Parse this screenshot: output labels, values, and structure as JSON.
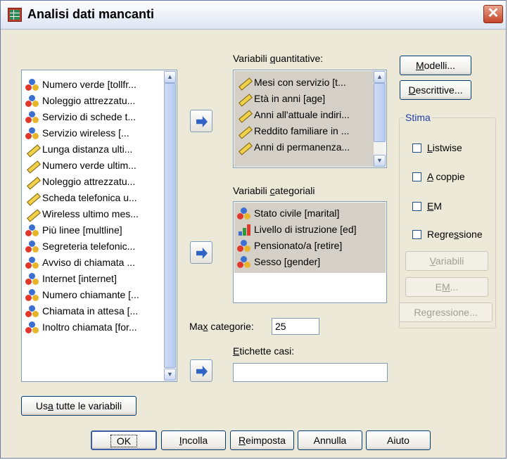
{
  "window": {
    "title": "Analisi dati mancanti",
    "close_glyph": "✕",
    "icon": "data-grid-icon"
  },
  "left_list": {
    "items": [
      {
        "label": "Numero verde [tollfr...",
        "type": "nominal"
      },
      {
        "label": "Noleggio attrezzatu...",
        "type": "nominal"
      },
      {
        "label": "Servizio di schede t...",
        "type": "nominal"
      },
      {
        "label": "Servizio wireless [...",
        "type": "nominal"
      },
      {
        "label": "Lunga distanza ulti...",
        "type": "scale"
      },
      {
        "label": "Numero verde ultim...",
        "type": "scale"
      },
      {
        "label": "Noleggio attrezzatu...",
        "type": "scale"
      },
      {
        "label": "Scheda telefonica u...",
        "type": "scale"
      },
      {
        "label": "Wireless ultimo mes...",
        "type": "scale"
      },
      {
        "label": "Più linee [multline]",
        "type": "nominal"
      },
      {
        "label": "Segreteria telefonic...",
        "type": "nominal"
      },
      {
        "label": "Avviso di chiamata ...",
        "type": "nominal"
      },
      {
        "label": "Internet [internet]",
        "type": "nominal"
      },
      {
        "label": "Numero chiamante [...",
        "type": "nominal"
      },
      {
        "label": "Chiamata in attesa [...",
        "type": "nominal"
      },
      {
        "label": "Inoltro chiamata [for...",
        "type": "nominal"
      }
    ]
  },
  "quantitative": {
    "label_pre": "Variabili ",
    "label_u": "q",
    "label_post": "uantitative:",
    "items": [
      {
        "label": "Mesi con servizio [t...",
        "type": "scale"
      },
      {
        "label": "Età in anni [age]",
        "type": "scale"
      },
      {
        "label": "Anni all'attuale indiri...",
        "type": "scale"
      },
      {
        "label": "Reddito familiare in ...",
        "type": "scale"
      },
      {
        "label": "Anni di permanenza...",
        "type": "scale"
      }
    ]
  },
  "categorical": {
    "label_pre": "Variabili ",
    "label_u": "c",
    "label_post": "ategoriali",
    "items": [
      {
        "label": "Stato civile [marital]",
        "type": "nominal"
      },
      {
        "label": "Livello di istruzione [ed]",
        "type": "ordinal"
      },
      {
        "label": "Pensionato/a [retire]",
        "type": "nominal"
      },
      {
        "label": "Sesso [gender]",
        "type": "nominal"
      }
    ]
  },
  "max_categories": {
    "label_pre": "Ma",
    "label_u": "x",
    "label_post": " categorie:",
    "value": "25"
  },
  "case_labels": {
    "label_u": "E",
    "label_post": "tichette casi:",
    "value": ""
  },
  "side_buttons": {
    "models": {
      "pre": "",
      "u": "M",
      "post": "odelli..."
    },
    "descriptives": {
      "pre": "",
      "u": "D",
      "post": "escrittive..."
    }
  },
  "estimate": {
    "title": "Stima",
    "options": [
      {
        "pre": "",
        "u": "L",
        "post": "istwise",
        "checked": false
      },
      {
        "pre": "",
        "u": "A",
        "post": " coppie",
        "checked": false
      },
      {
        "pre": "",
        "u": "E",
        "post": "M",
        "checked": false
      },
      {
        "pre": "Regre",
        "u": "s",
        "post": "sione",
        "checked": false
      }
    ],
    "variables_btn": {
      "pre": "",
      "u": "V",
      "post": "ariabili"
    },
    "em_btn": {
      "pre": "E",
      "u": "M",
      "post": "..."
    },
    "regression_btn": {
      "pre": "Regressione...",
      "u": "",
      "post": ""
    }
  },
  "use_all_button": {
    "pre": "Us",
    "u": "a",
    "post": " tutte le variabili"
  },
  "bottom_buttons": {
    "ok": "OK",
    "paste": {
      "pre": "",
      "u": "I",
      "post": "ncolla"
    },
    "reset": {
      "pre": "",
      "u": "R",
      "post": "eimposta"
    },
    "cancel": "Annulla",
    "help": "Aiuto"
  }
}
